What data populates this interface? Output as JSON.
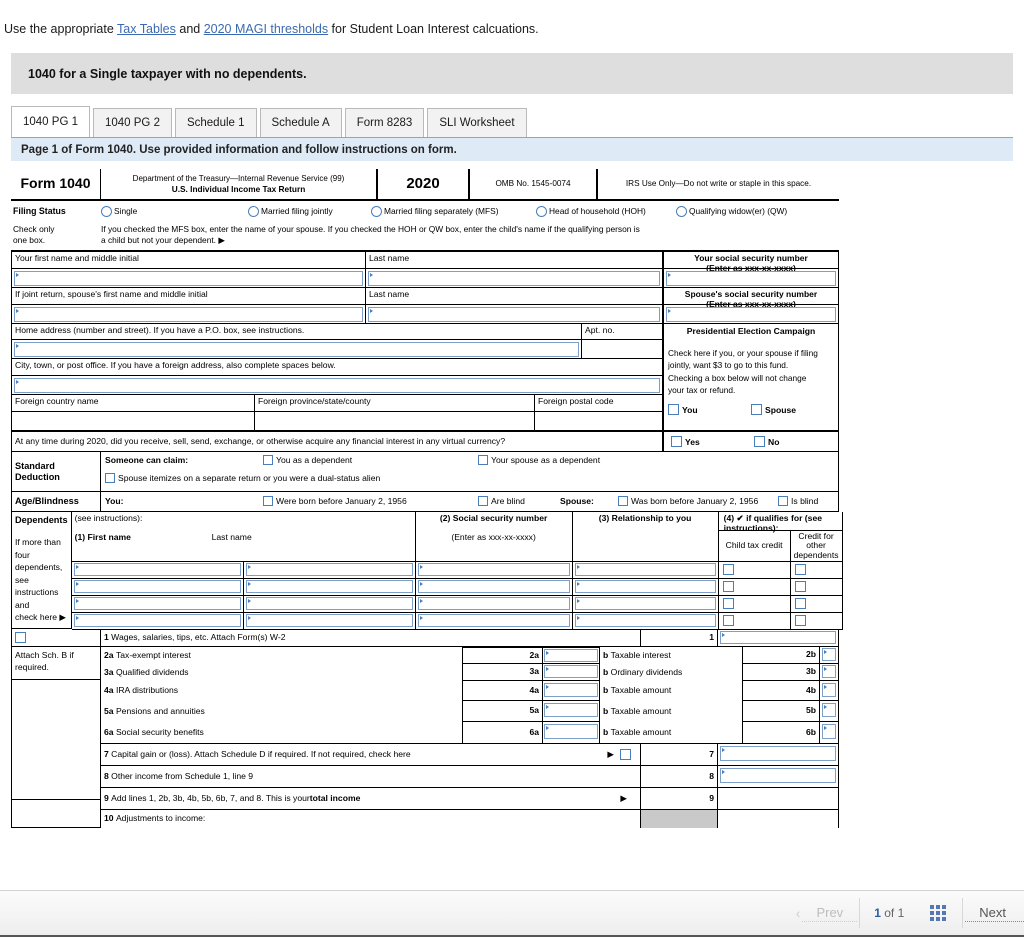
{
  "top_note": {
    "pre": "Use the appropriate ",
    "link1": "Tax Tables",
    "mid": " and ",
    "link2": "2020 MAGI thresholds",
    "post": " for Student Loan Interest calcuations."
  },
  "banner": {
    "title": "1040 for a Single taxpayer with no dependents."
  },
  "tabs": [
    {
      "label": "1040 PG 1",
      "active": true
    },
    {
      "label": "1040 PG 2",
      "active": false
    },
    {
      "label": "Schedule 1",
      "active": false
    },
    {
      "label": "Schedule A",
      "active": false
    },
    {
      "label": "Form 8283",
      "active": false
    },
    {
      "label": "SLI Worksheet",
      "active": false
    }
  ],
  "instruction_bar": {
    "text": "Page 1 of Form 1040. Use provided information and follow instructions on form."
  },
  "form_header": {
    "form_name": "Form 1040",
    "dept_line1": "Department of the Treasury—Internal Revenue Service (99)",
    "dept_line2": "U.S. Individual Income Tax Return",
    "year": "2020",
    "omb": "OMB No. 1545-0074",
    "irs_use": "IRS Use Only—Do not write or staple in this space."
  },
  "filing_status": {
    "label": "Filing Status",
    "options": [
      "Single",
      "Married filing jointly",
      "Married filing separately (MFS)",
      "Head of household (HOH)",
      "Qualifying widow(er) (QW)"
    ],
    "check_only_line1": "Check only",
    "check_only_line2": "one box.",
    "mfs_note_line1": "If you checked the MFS box, enter the name of your spouse. If you checked the HOH or QW box, enter the child's name if the qualifying person is",
    "mfs_note_line2": "a child but not your dependent. ▶"
  },
  "name_section": {
    "your_first_name": "Your first name and middle initial",
    "last_name": "Last name",
    "your_ssn_l1": "Your social security number",
    "your_ssn_l2": "(Enter as xxx-xx-xxxx)",
    "spouse_first_name": "If joint return, spouse's first name and middle initial",
    "spouse_last_name": "Last name",
    "spouse_ssn_l1": "Spouse's social security number",
    "spouse_ssn_l2": "(Enter as xxx-xx-xxxx)"
  },
  "address_section": {
    "home_address": "Home address (number and street). If you have a P.O. box, see instructions.",
    "apt_no": "Apt. no.",
    "city": "City, town, or post office. If you have a foreign address, also complete spaces below.",
    "foreign_country": "Foreign country name",
    "foreign_province": "Foreign province/state/county",
    "foreign_postal": "Foreign postal code"
  },
  "pec": {
    "title": "Presidential Election Campaign",
    "body_l1": "Check here if you, or your spouse if filing",
    "body_l2": "jointly, want $3 to go to this fund.",
    "body_l3": "Checking a box below will not change",
    "body_l4": "your tax or refund.",
    "you": "You",
    "spouse": "Spouse"
  },
  "virtual_currency": {
    "question": "At any time during 2020, did you receive, sell, send, exchange, or otherwise acquire any financial interest in any virtual currency?",
    "yes": "Yes",
    "no": "No"
  },
  "standard_deduction": {
    "label_l1": "Standard",
    "label_l2": "Deduction",
    "someone_can_claim": "Someone can claim:",
    "you_as_dependent": "You as a dependent",
    "spouse_as_dependent": "Your spouse as a dependent",
    "spouse_itemizes": "Spouse itemizes on a separate return or you were a dual-status alien"
  },
  "age_blindness": {
    "label": "Age/Blindness",
    "you": "You:",
    "you_born": "Were born before January 2, 1956",
    "you_blind": "Are blind",
    "spouse": "Spouse:",
    "spouse_born": "Was born before January 2, 1956",
    "spouse_blind": "Is blind"
  },
  "dependents": {
    "label": "Dependents",
    "side_note_l1": "If more than four",
    "side_note_l2": "dependents, see",
    "side_note_l3": "instructions and",
    "side_note_l4": "check here ▶",
    "see_instructions": "(see instructions):",
    "col1": "(1) First name",
    "col1b": "Last name",
    "col2": "(2) Social security number",
    "col2b": "(Enter as xxx-xx-xxxx)",
    "col3": "(3) Relationship to you",
    "col4": "(4) ✔ if qualifies for (see instructions):",
    "col4a": "Child tax credit",
    "col4b_l1": "Credit for other",
    "col4b_l2": "dependents",
    "rows": 4
  },
  "income": {
    "attach_note_l1": "Attach Sch. B if",
    "attach_note_l2": "required.",
    "lines": [
      {
        "no": "1",
        "desc": "Wages, salaries, tips, etc. Attach Form(s) W-2",
        "mid_no": "",
        "mid_desc": "",
        "right_no": "1"
      },
      {
        "no": "2a",
        "desc": "Tax-exempt interest",
        "mid_no": "2a",
        "mid_desc": "Taxable interest",
        "right_no": "2b"
      },
      {
        "no": "3a",
        "desc": "Qualified dividends",
        "mid_no": "3a",
        "mid_desc": "Ordinary dividends",
        "right_no": "3b"
      },
      {
        "no": "4a",
        "desc": "IRA distributions",
        "mid_no": "4a",
        "mid_desc": "Taxable amount",
        "right_no": "4b"
      },
      {
        "no": "5a",
        "desc": "Pensions and annuities",
        "mid_no": "5a",
        "mid_desc": "Taxable amount",
        "right_no": "5b"
      },
      {
        "no": "6a",
        "desc": "Social security benefits",
        "mid_no": "6a",
        "mid_desc": "Taxable amount",
        "right_no": "6b"
      }
    ],
    "line7": {
      "no": "7",
      "desc": "Capital gain or (loss). Attach Schedule D if required. If not required, check here",
      "right_no": "7"
    },
    "line8": {
      "no": "8",
      "desc": "Other income from Schedule 1, line 9",
      "right_no": "8"
    },
    "line9": {
      "no": "9",
      "desc_a": "Add lines 1, 2b, 3b, 4b, 5b, 6b, 7, and 8. This is your ",
      "desc_b": "total income",
      "right_no": "9"
    },
    "line10": {
      "no": "10",
      "desc": "Adjustments to income:"
    }
  },
  "bottom_nav": {
    "prev": "Prev",
    "page_current": "1",
    "page_of": "of",
    "page_total": "1",
    "next": "Next"
  }
}
